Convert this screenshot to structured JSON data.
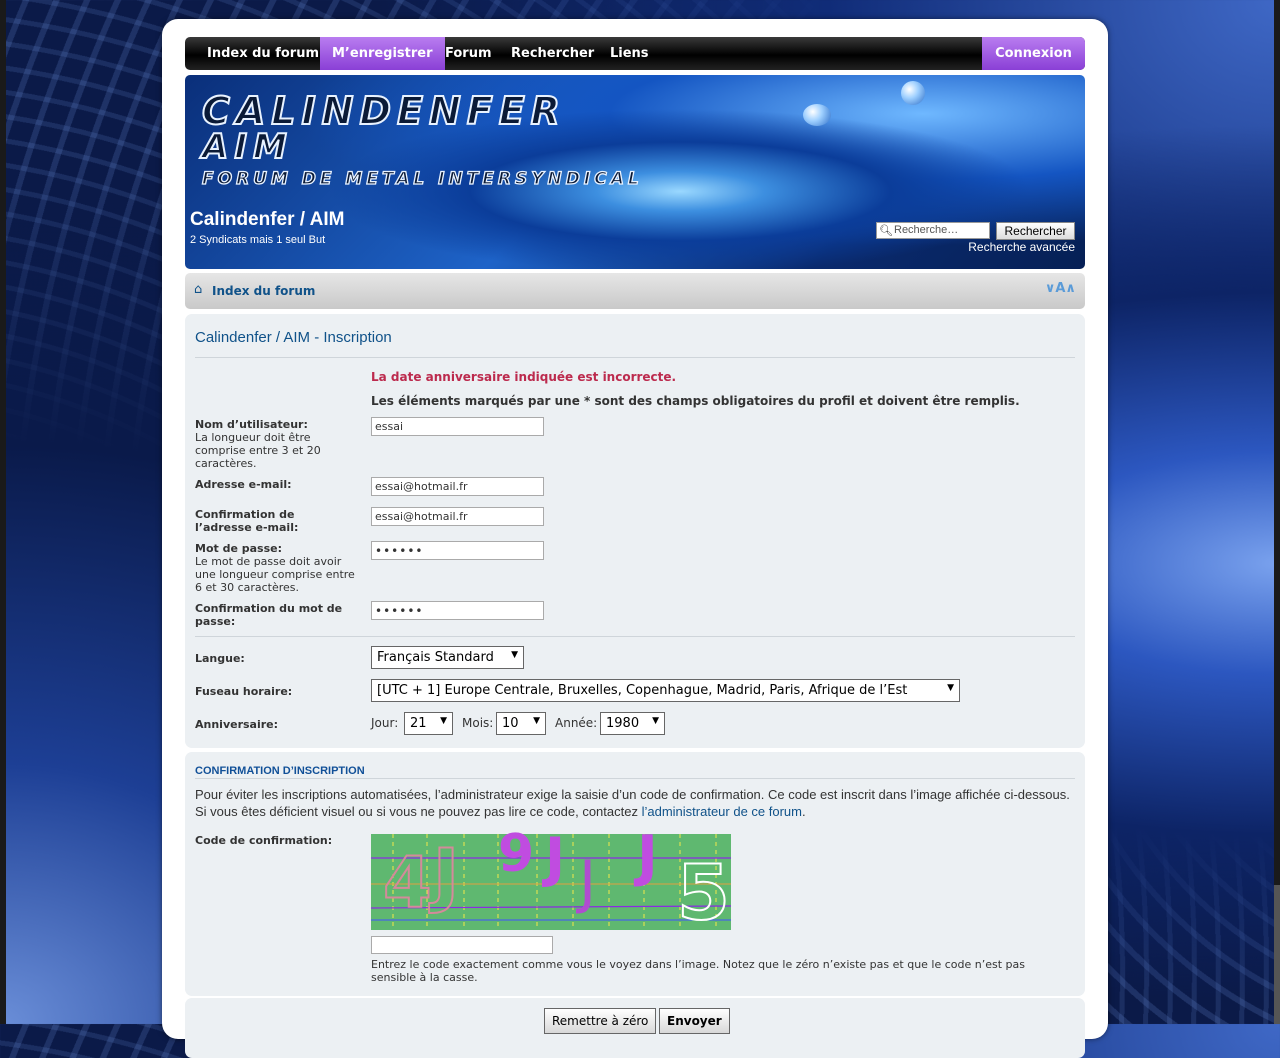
{
  "nav": {
    "items": [
      {
        "label": "Index du forum"
      },
      {
        "label": "M’enregistrer"
      },
      {
        "label": "Forum"
      },
      {
        "label": "Rechercher"
      },
      {
        "label": "Liens"
      }
    ],
    "login": "Connexion"
  },
  "header": {
    "logo_line1": "CALINDENFER",
    "logo_line2": "AIM",
    "logo_line3": "FORUM DE METAL INTERSYNDICAL",
    "site_title": "Calindenfer / AIM",
    "site_desc": "2 Syndicats mais 1 seul But",
    "search_placeholder": "Recherche…",
    "search_button": "Rechercher",
    "advanced_search": "Recherche avancée"
  },
  "breadcrumb": {
    "label": "Index du forum",
    "font_size_toggle": "∨A∧"
  },
  "form": {
    "title": "Calindenfer / AIM - Inscription",
    "error": "La date anniversaire indiquée est incorrecte.",
    "required_note": "Les éléments marqués par une * sont des champs obligatoires du profil et doivent être remplis.",
    "username_label": "Nom d’utilisateur:",
    "username_help": "La longueur doit être comprise entre 3 et 20 caractères.",
    "username_value": "essai",
    "email_label": "Adresse e-mail:",
    "email_value": "essai@hotmail.fr",
    "email_confirm_label": "Confirmation de l’adresse e-mail:",
    "email_confirm_value": "essai@hotmail.fr",
    "password_label": "Mot de passe:",
    "password_help": "Le mot de passe doit avoir une longueur comprise entre 6 et 30 caractères.",
    "password_value": "••••••",
    "password_confirm_label": "Confirmation du mot de passe:",
    "password_confirm_value": "••••••",
    "lang_label": "Langue:",
    "lang_value": "Français Standard",
    "tz_label": "Fuseau horaire:",
    "tz_value": "[UTC + 1] Europe Centrale, Bruxelles, Copenhague, Madrid, Paris, Afrique de l’Est",
    "birthday_label": "Anniversaire:",
    "day_label": "Jour:",
    "day_value": "21",
    "month_label": "Mois:",
    "month_value": "10",
    "year_label": "Année:",
    "year_value": "1980"
  },
  "confirm": {
    "heading": "CONFIRMATION D’INSCRIPTION",
    "text_before": "Pour éviter les inscriptions automatisées, l’administrateur exige la saisie d’un code de confirmation. Ce code est inscrit dans l’image affichée ci-dessous. Si vous êtes déficient visuel ou si vous ne pouvez pas lire ce code, contactez ",
    "admin_link": "l’administrateur de ce forum",
    "text_after": ".",
    "code_label": "Code de confirmation:",
    "captcha_chars": [
      "4",
      "J",
      "9",
      "J",
      "J",
      "J",
      "5"
    ],
    "help": "Entrez le code exactement comme vous le voyez dans l’image. Notez que le zéro n’existe pas et que le code n’est pas sensible à la casse."
  },
  "buttons": {
    "reset": "Remettre à zéro",
    "submit": "Envoyer"
  },
  "colors": {
    "nav_active": "#9b50e0",
    "link": "#105289",
    "error": "#bc2a4d",
    "captcha_bg": "#5fb870"
  }
}
